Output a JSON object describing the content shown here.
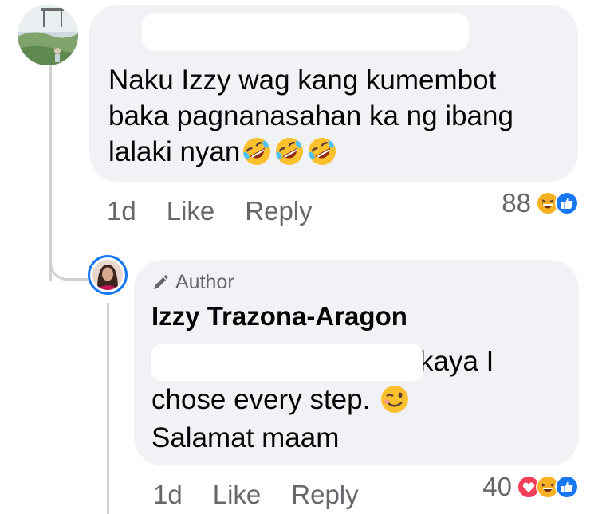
{
  "comment": {
    "text_lines": [
      "Naku Izzy wag kang kumembot",
      "baka pagnanasahan ka ng ibang",
      "lalaki nyan"
    ],
    "emojis": [
      "rolling-on-floor-laughing-icon",
      "rolling-on-floor-laughing-icon",
      "rolling-on-floor-laughing-icon"
    ],
    "time": "1d",
    "like_label": "Like",
    "reply_label": "Reply",
    "reaction_count": "88",
    "reactions": [
      "haha-icon",
      "like-icon"
    ]
  },
  "reply": {
    "author_tag": "Author",
    "name": "Izzy Trazona-Aragon",
    "text_line1": "kaya I",
    "text_line2": "chose every step.",
    "text_line3": "Salamat maam",
    "emoji": "winking-face-icon",
    "time": "1d",
    "like_label": "Like",
    "reply_label": "Reply",
    "reaction_count": "40",
    "reactions": [
      "love-icon",
      "haha-icon",
      "like-icon"
    ]
  },
  "colors": {
    "bubble": "#f0f2f5",
    "meta_text": "#65676b",
    "like_blue": "#1877f2",
    "love_red": "#f33e58",
    "haha_yellow": "#f7b125"
  }
}
